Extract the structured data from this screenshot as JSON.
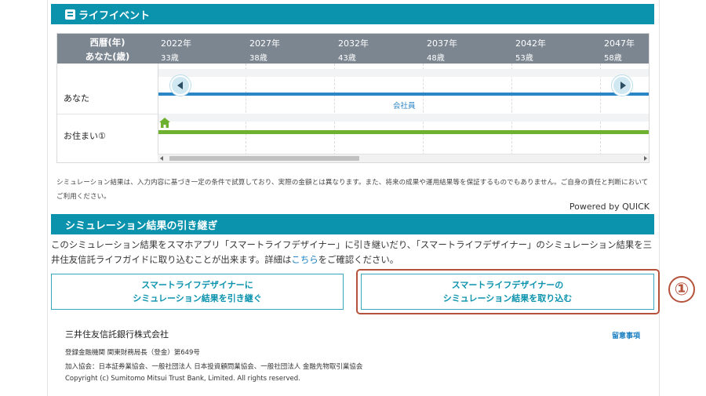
{
  "life_event": {
    "title": "ライフイベント",
    "header_labels": {
      "year": "西暦(年)",
      "age": "あなた(歳)"
    },
    "columns": [
      {
        "year": "2022年",
        "age": "33歳"
      },
      {
        "year": "2027年",
        "age": "38歳"
      },
      {
        "year": "2032年",
        "age": "43歳"
      },
      {
        "year": "2037年",
        "age": "48歳"
      },
      {
        "year": "2042年",
        "age": "53歳"
      },
      {
        "year": "2047年",
        "age": "58歳"
      }
    ],
    "rows": {
      "you": "あなた",
      "home": "お住まい①"
    },
    "job_label": "会社員",
    "colors": {
      "job_bar": "#2b86c5",
      "home_bar": "#6eb02f",
      "header": "#7c8691"
    }
  },
  "disclaimer": "シミュレーション結果は、入力内容に基づき一定の条件で試算しており、実際の金額とは異なります。また、将来の成果や運用結果等を保証するものでもありません。ご自身の責任と判断においてご利用ください。",
  "powered_by": "Powered by QUICK",
  "handover": {
    "title": "シミュレーション結果の引き継ぎ",
    "intro_before_link": "このシミュレーション結果をスマホアプリ「スマートライフデザイナー」に引き継いだり、「スマートライフデザイナー」のシミュレーション結果を三井住友信託ライフガイドに取り込むことが出来ます。詳細は",
    "link": "こちら",
    "intro_after_link": "をご確認ください。",
    "button_left": {
      "line1": "スマートライフデザイナーに",
      "line2": "シミュレーション結果を引き継ぐ"
    },
    "button_right": {
      "line1": "スマートライフデザイナーの",
      "line2": "シミュレーション結果を取り込む"
    },
    "callout": "①"
  },
  "footer": {
    "company": "三井住友信託銀行株式会社",
    "notice": "留意事項",
    "registration": "登録金融機関 関東財務局長（登金）第649号",
    "associations": "加入協会：日本証券業協会、一般社団法人 日本投資顧問業協会、一般社団法人 金融先物取引業協会",
    "copyright": "Copyright (c) Sumitomo Mitsui Trust Bank, Limited. All rights reserved."
  },
  "accent_color": "#0b93ae",
  "callout_color": "#b5523b"
}
